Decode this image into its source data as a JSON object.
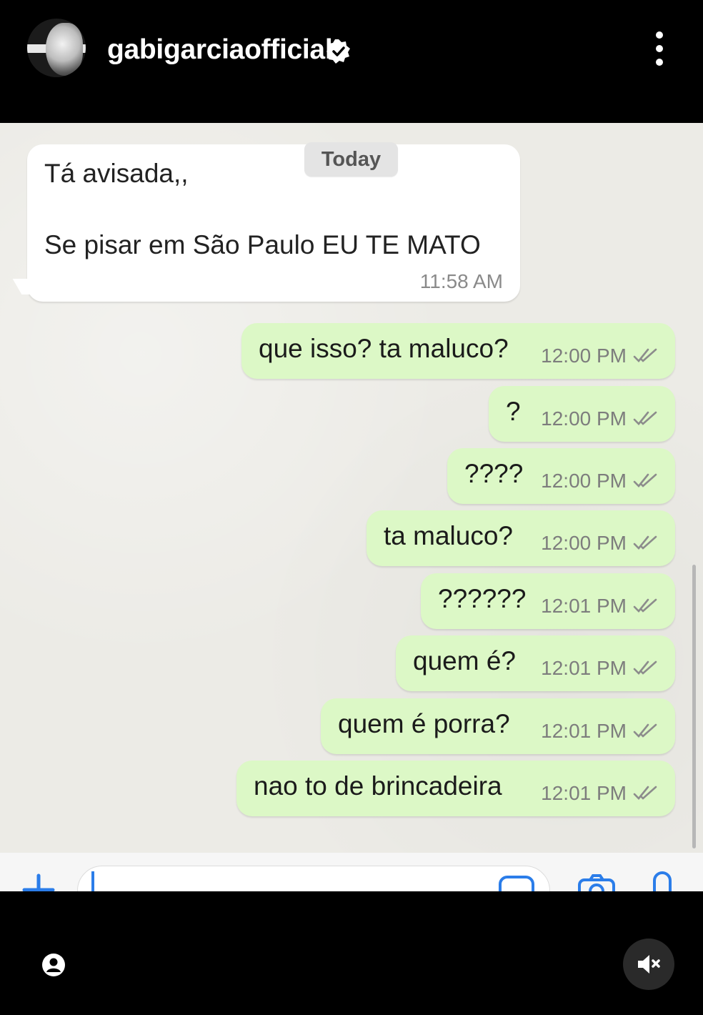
{
  "header": {
    "username": "gabigarciaofficial",
    "verified_icon": "verified-badge-icon",
    "more_icon": "more-vertical-icon"
  },
  "chat": {
    "date_label": "Today",
    "incoming": {
      "line1": "Tá avisada,,",
      "line2": "Se pisar em São Paulo EU TE MATO",
      "time": "11:58 AM"
    },
    "outgoing": [
      {
        "text": "que isso? ta maluco?",
        "time": "12:00 PM"
      },
      {
        "text": "?",
        "time": "12:00 PM"
      },
      {
        "text": "????",
        "time": "12:00 PM"
      },
      {
        "text": "ta maluco?",
        "time": "12:00 PM"
      },
      {
        "text": "??????",
        "time": "12:01 PM"
      },
      {
        "text": "quem é?",
        "time": "12:01 PM"
      },
      {
        "text": "quem é porra?",
        "time": "12:01 PM"
      },
      {
        "text": "nao to de brincadeira",
        "time": "12:01 PM"
      }
    ]
  },
  "colors": {
    "outgoing_bubble": "#dcf8c6",
    "incoming_bubble": "#ffffff",
    "accent": "#2b7de9"
  }
}
